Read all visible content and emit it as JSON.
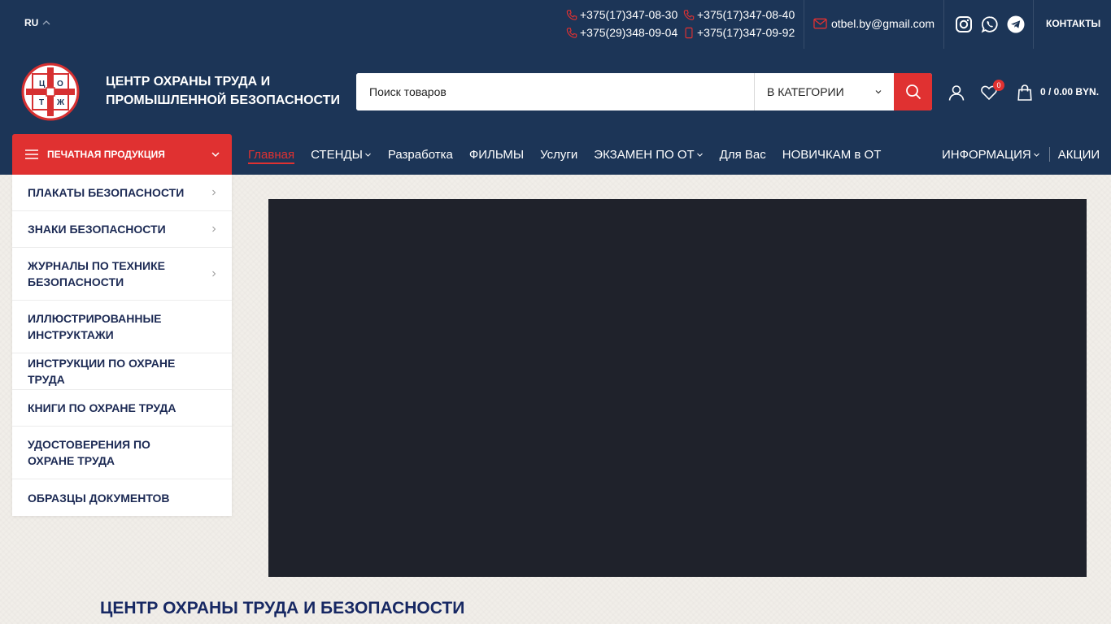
{
  "topbar": {
    "language": "RU",
    "phones": [
      "+375(17)347-08-30",
      "+375(17)347-08-40",
      "+375(29)348-09-04",
      "+375(17)347-09-92"
    ],
    "email": "otbel.by@gmail.com",
    "social_icons": [
      "instagram-icon",
      "whatsapp-icon",
      "telegram-icon"
    ],
    "contacts_label": "КОНТАКТЫ"
  },
  "header": {
    "site_title": "ЦЕНТР ОХРАНЫ ТРУДА И ПРОМЫШЛЕННОЙ БЕЗОПАСНОСТИ",
    "logo_letters": [
      "Ц",
      "О",
      "Т",
      "Ж"
    ],
    "search": {
      "placeholder": "Поиск товаров",
      "category_select": "В КАТЕГОРИИ"
    },
    "wishlist_count": "0",
    "cart_total": "0 / 0.00 BYN."
  },
  "nav": {
    "category_toggle": "ПЕЧАТНАЯ ПРОДУКЦИЯ",
    "menu": [
      "Главная",
      "СТЕНДЫ",
      "Разработка",
      "ФИЛЬМЫ",
      "Услуги",
      "ЭКЗАМЕН ПО ОТ",
      "Для Вас",
      "НОВИЧКАМ в ОТ"
    ],
    "menu_right": [
      "ИНФОРМАЦИЯ",
      "АКЦИИ"
    ]
  },
  "categories": [
    "ПЛАКАТЫ БЕЗОПАСНОСТИ",
    "ЗНАКИ БЕЗОПАСНОСТИ",
    "ЖУРНАЛЫ ПО ТЕХНИКЕ БЕЗОПАСНОСТИ",
    "ИЛЛЮСТРИРОВАННЫЕ ИНСТРУКТАЖИ",
    "ИНСТРУКЦИИ ПО ОХРАНЕ ТРУДА",
    "КНИГИ ПО ОХРАНЕ ТРУДА",
    "УДОСТОВЕРЕНИЯ ПО ОХРАНЕ ТРУДА",
    "ОБРАЗЦЫ ДОКУМЕНТОВ"
  ],
  "main": {
    "section_title": "ЦЕНТР ОХРАНЫ ТРУДА И БЕЗОПАСНОСТИ"
  },
  "colors": {
    "navy": "#1c3557",
    "accent_red": "#e03131",
    "category_text": "#1c2a54",
    "video_bg": "#1f222b"
  }
}
